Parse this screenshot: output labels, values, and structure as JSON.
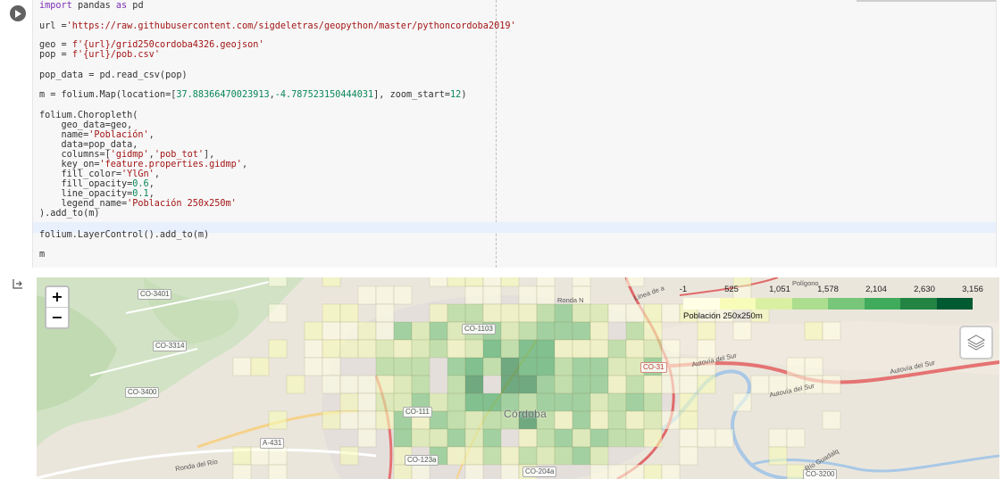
{
  "notebook": {
    "run_button_icon": "play-icon",
    "output_icon": "output-redirect-icon",
    "code_lines": [
      {
        "parts": [
          {
            "t": "import",
            "c": "kw"
          },
          {
            "t": " pandas "
          },
          {
            "t": "as",
            "c": "kw"
          },
          {
            "t": " pd"
          }
        ]
      },
      {
        "parts": [
          {
            "t": "url ="
          },
          {
            "t": "'https://raw.githubusercontent.com/sigdeletras/geopython/master/pythoncordoba2019'",
            "c": "str"
          }
        ]
      },
      {
        "parts": [
          {
            "t": "geo = "
          },
          {
            "t": "f'{url}/grid250cordoba4326.geojson'",
            "c": "str"
          }
        ]
      },
      {
        "parts": [
          {
            "t": "pop = "
          },
          {
            "t": "f'{url}/pob.csv'",
            "c": "str"
          }
        ]
      },
      {
        "parts": [
          {
            "t": "pop_data = pd.read_csv(pop)"
          }
        ]
      },
      {
        "parts": [
          {
            "t": "m = folium.Map(location=["
          },
          {
            "t": "37.88366470023913",
            "c": "num"
          },
          {
            "t": ","
          },
          {
            "t": "-4.787523150444031",
            "c": "num"
          },
          {
            "t": "], zoom_start="
          },
          {
            "t": "12",
            "c": "num"
          },
          {
            "t": ")"
          }
        ]
      },
      {
        "parts": [
          {
            "t": "folium.Choropleth("
          }
        ]
      },
      {
        "parts": [
          {
            "t": "    geo_data=geo,"
          }
        ]
      },
      {
        "parts": [
          {
            "t": "    name="
          },
          {
            "t": "'Población'",
            "c": "str"
          },
          {
            "t": ","
          }
        ]
      },
      {
        "parts": [
          {
            "t": "    data=pop_data,"
          }
        ]
      },
      {
        "parts": [
          {
            "t": "    columns=["
          },
          {
            "t": "'gidmp'",
            "c": "str"
          },
          {
            "t": ","
          },
          {
            "t": "'pob_tot'",
            "c": "str"
          },
          {
            "t": "],"
          }
        ]
      },
      {
        "parts": [
          {
            "t": "    key_on="
          },
          {
            "t": "'feature.properties.gidmp'",
            "c": "str"
          },
          {
            "t": ","
          }
        ]
      },
      {
        "parts": [
          {
            "t": "    fill_color="
          },
          {
            "t": "'YlGn'",
            "c": "str"
          },
          {
            "t": ","
          }
        ]
      },
      {
        "parts": [
          {
            "t": "    fill_opacity="
          },
          {
            "t": "0.6",
            "c": "num"
          },
          {
            "t": ","
          }
        ]
      },
      {
        "parts": [
          {
            "t": "    line_opacity="
          },
          {
            "t": "0.1",
            "c": "num"
          },
          {
            "t": ","
          }
        ]
      },
      {
        "parts": [
          {
            "t": "    legend_name="
          },
          {
            "t": "'Población 250x250m'",
            "c": "str"
          }
        ]
      },
      {
        "parts": [
          {
            "t": ").add_to(m)"
          }
        ]
      },
      {
        "parts": [
          {
            "t": "folium.LayerControl().add_to(m)"
          }
        ]
      },
      {
        "parts": [
          {
            "t": "m"
          }
        ]
      }
    ]
  },
  "map": {
    "zoom_in": "+",
    "zoom_out": "−",
    "layers_icon": "layers-icon",
    "legend": {
      "ticks": [
        "-1",
        "525",
        "1,051",
        "1,578",
        "2,104",
        "2,630",
        "3,156"
      ],
      "title": "Población 250x250m",
      "colors": [
        "#ffffe5",
        "#f7fcb9",
        "#d9f0a3",
        "#addd8e",
        "#78c679",
        "#41ab5d",
        "#238443",
        "#005a32"
      ]
    },
    "road_labels": {
      "co3401": "CO-3401",
      "co3314": "CO-3314",
      "co3400": "CO-3400",
      "a431": "A-431",
      "co31": "CO-31",
      "co1103": "CO-1103",
      "co1110": "CO-111",
      "co123a": "CO-123a",
      "co204a": "CO-204a",
      "co3200": "CO-3200"
    },
    "city_label": "Córdoba",
    "street_labels": {
      "ronda": "Ronda N",
      "autovia1": "Autovía del Sur",
      "autovia2": "Autovía del Sur",
      "autovia3": "Autovía del Sur",
      "linea": "Línea de a",
      "poligono": "Polígono",
      "ronda_rio": "Ronda del Río",
      "guadal": "Río Guadalq"
    }
  }
}
